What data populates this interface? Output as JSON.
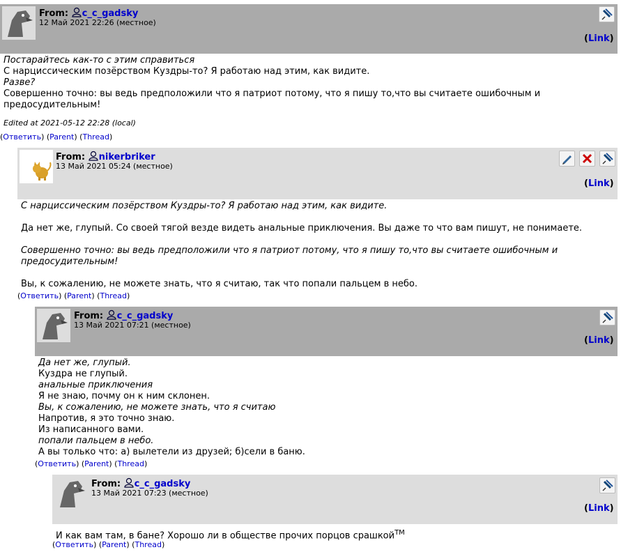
{
  "labels": {
    "from": "From:",
    "link": "Link",
    "reply": "Ответить",
    "parent": "Parent",
    "thread": "Thread"
  },
  "comments": [
    {
      "author": "c_c_gadsky",
      "date": "12 Май 2021 22:26 (местное)",
      "lines": [
        {
          "text": "Постарайтесь как-то с этим справиться",
          "italic": true
        },
        {
          "text": "С нарциссическим позёрством Куздры-то? Я работаю над этим, как видите.",
          "italic": false
        },
        {
          "text": "Разве?",
          "italic": true
        },
        {
          "text": "Совершенно точно: вы ведь предположили что я патриот потому, что я пишу то,что вы считаете ошибочным и",
          "italic": false
        },
        {
          "text": "предосудительным!",
          "italic": false
        }
      ],
      "edited": "Edited at 2021-05-12 22:28 (local)"
    },
    {
      "author": "nikerbriker",
      "date": "13 Май 2021 05:24 (местное)",
      "lines": [
        {
          "text": "С нарциссическим позёрством Куздры-то? Я работаю над этим, как видите.",
          "italic": true
        },
        {
          "text": "Да нет же, глупый. Со своей тягой везде видеть анальные приключения. Вы даже то что вам пишут, не понимаете.",
          "italic": false
        },
        {
          "text": "Совершенно точно: вы ведь предположили что я патриот потому, что я пишу то,что вы считаете ошибочным и",
          "italic": true
        },
        {
          "text": "предосудительным!",
          "italic": true
        },
        {
          "text": "Вы, к сожалению, не можете знать, что я считаю, так что попали пальцем в небо.",
          "italic": false
        }
      ]
    },
    {
      "author": "c_c_gadsky",
      "date": "13 Май 2021 07:21 (местное)",
      "lines": [
        {
          "text": "Да нет же, глупый.",
          "italic": true
        },
        {
          "text": "Куздра не глупый.",
          "italic": false
        },
        {
          "text": "анальные приключения",
          "italic": true
        },
        {
          "text": "Я не знаю, почму он к ним склонен.",
          "italic": false
        },
        {
          "text": "Вы, к сожалению, не можете знать, что я считаю",
          "italic": true
        },
        {
          "text": "Напротив, я это точно знаю.",
          "italic": false
        },
        {
          "text": "Из написанного вами.",
          "italic": false
        },
        {
          "text": "попали пальцем в небо.",
          "italic": true
        },
        {
          "text": "А вы только что: а) вылетели из друзей; б)сели в баню.",
          "italic": false
        }
      ]
    },
    {
      "author": "c_c_gadsky",
      "date": "13 Май 2021 07:23 (местное)",
      "lines": [
        {
          "text": "И как вам там, в бане? Хорошо ли в обществе прочих порцов срашкой",
          "italic": false
        }
      ],
      "sup": "TM"
    }
  ],
  "icons": [
    "user-icon",
    "edit-icon",
    "delete-icon",
    "pin-icon"
  ],
  "colors": {
    "header_dark": "#aaaaaa",
    "header_light": "#dddddd",
    "link": "#0000cc",
    "delete": "#cc0000"
  }
}
